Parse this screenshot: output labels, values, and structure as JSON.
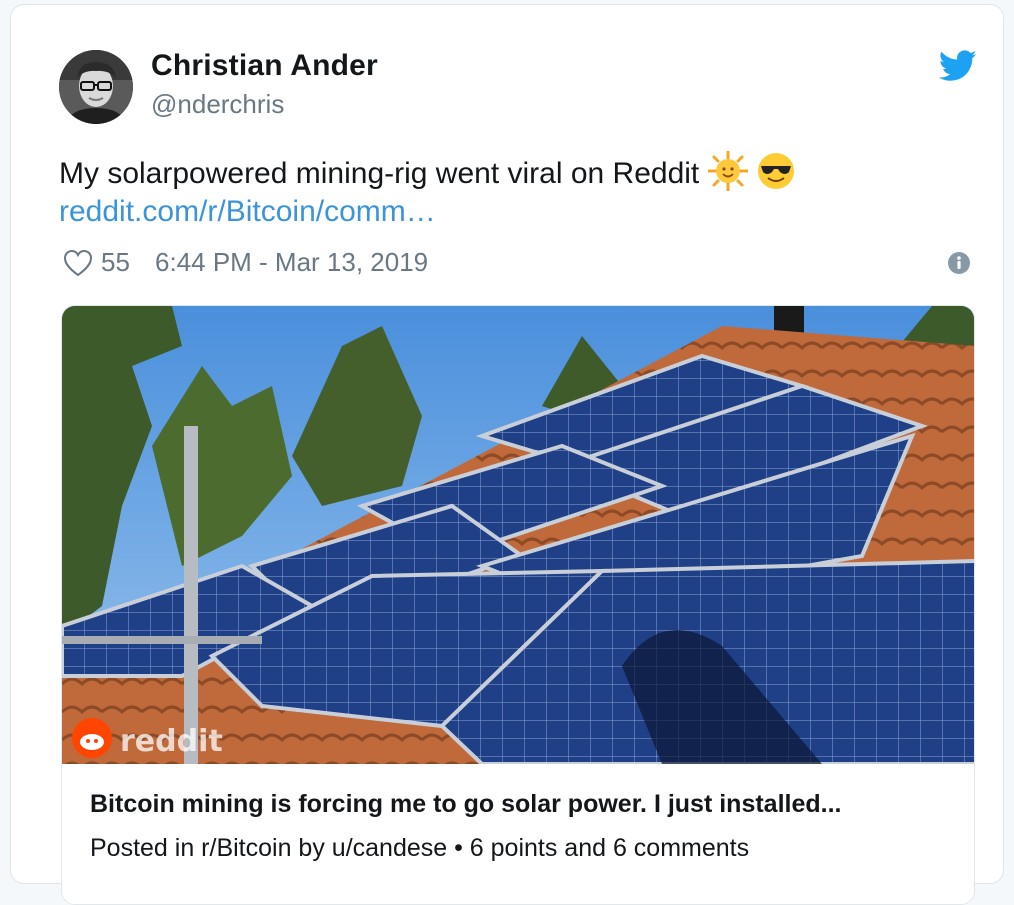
{
  "tweet": {
    "author_name": "Christian Ander",
    "author_handle": "@nderchris",
    "text": "My solarpowered mining-rig went viral on Reddit",
    "emojis": [
      "sun-with-face-emoji",
      "smiling-face-with-sunglasses-emoji"
    ],
    "link_text": "reddit.com/r/Bitcoin/comm…",
    "like_count": "55",
    "timestamp": "6:44 PM - Mar 13, 2019"
  },
  "link_card": {
    "image_subject": "solar panels on a tiled roof",
    "watermark": "reddit",
    "title": "Bitcoin mining is forcing me to go solar power. I just installed...",
    "description": "Posted in r/Bitcoin by u/candese • 6 points and 6 comments"
  },
  "colors": {
    "link": "#3b94d9",
    "twitter_blue": "#1da1f2",
    "muted": "#697882",
    "reddit_orange": "#ff4500"
  },
  "icons": {
    "brand": "twitter-bird-icon",
    "like": "heart-icon",
    "info": "info-icon",
    "watermark": "reddit-logo-icon"
  }
}
